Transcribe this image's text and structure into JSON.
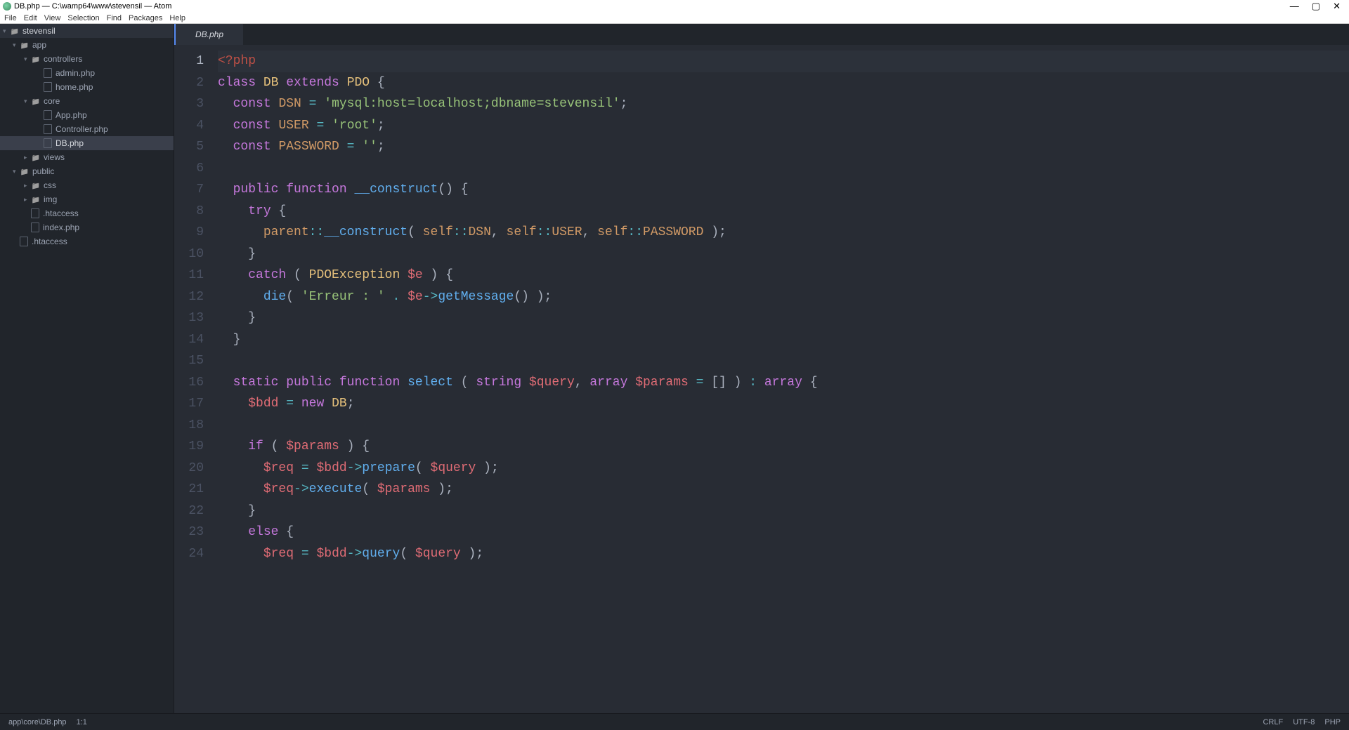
{
  "title": "DB.php — C:\\wamp64\\www\\stevensil — Atom",
  "window": {
    "min": "—",
    "max": "▢",
    "close": "✕"
  },
  "menu": [
    "File",
    "Edit",
    "View",
    "Selection",
    "Find",
    "Packages",
    "Help"
  ],
  "project": {
    "root": "stevensil",
    "tree": [
      {
        "type": "folder",
        "name": "app",
        "open": true,
        "depth": 1
      },
      {
        "type": "folder",
        "name": "controllers",
        "open": true,
        "depth": 2
      },
      {
        "type": "file",
        "name": "admin.php",
        "depth": 3
      },
      {
        "type": "file",
        "name": "home.php",
        "depth": 3
      },
      {
        "type": "folder",
        "name": "core",
        "open": true,
        "depth": 2
      },
      {
        "type": "file",
        "name": "App.php",
        "depth": 3
      },
      {
        "type": "file",
        "name": "Controller.php",
        "depth": 3
      },
      {
        "type": "file",
        "name": "DB.php",
        "depth": 3,
        "selected": true
      },
      {
        "type": "folder",
        "name": "views",
        "open": false,
        "depth": 2
      },
      {
        "type": "folder",
        "name": "public",
        "open": true,
        "depth": 1
      },
      {
        "type": "folder",
        "name": "css",
        "open": false,
        "depth": 2
      },
      {
        "type": "folder",
        "name": "img",
        "open": false,
        "depth": 2
      },
      {
        "type": "file",
        "name": ".htaccess",
        "depth": 2
      },
      {
        "type": "file",
        "name": "index.php",
        "depth": 2
      },
      {
        "type": "file",
        "name": ".htaccess",
        "depth": 1
      }
    ]
  },
  "tab": "DB.php",
  "status": {
    "path": "app\\core\\DB.php",
    "cursor": "1:1",
    "lineend": "CRLF",
    "encoding": "UTF-8",
    "lang": "PHP"
  },
  "code": [
    {
      "n": 1,
      "active": true,
      "spans": [
        [
          "phptag",
          "<?php"
        ]
      ]
    },
    {
      "n": 2,
      "spans": [
        [
          "k",
          "class"
        ],
        [
          "pn",
          " "
        ],
        [
          "cls",
          "DB"
        ],
        [
          "pn",
          " "
        ],
        [
          "k",
          "extends"
        ],
        [
          "pn",
          " "
        ],
        [
          "cls",
          "PDO"
        ],
        [
          "pn",
          " {"
        ]
      ]
    },
    {
      "n": 3,
      "spans": [
        [
          "pn",
          "  "
        ],
        [
          "k",
          "const"
        ],
        [
          "pn",
          " "
        ],
        [
          "cst",
          "DSN"
        ],
        [
          "pn",
          " "
        ],
        [
          "op",
          "="
        ],
        [
          "pn",
          " "
        ],
        [
          "str",
          "'mysql:host=localhost;dbname=stevensil'"
        ],
        [
          "pn",
          ";"
        ]
      ]
    },
    {
      "n": 4,
      "spans": [
        [
          "pn",
          "  "
        ],
        [
          "k",
          "const"
        ],
        [
          "pn",
          " "
        ],
        [
          "cst",
          "USER"
        ],
        [
          "pn",
          " "
        ],
        [
          "op",
          "="
        ],
        [
          "pn",
          " "
        ],
        [
          "str",
          "'root'"
        ],
        [
          "pn",
          ";"
        ]
      ]
    },
    {
      "n": 5,
      "spans": [
        [
          "pn",
          "  "
        ],
        [
          "k",
          "const"
        ],
        [
          "pn",
          " "
        ],
        [
          "cst",
          "PASSWORD"
        ],
        [
          "pn",
          " "
        ],
        [
          "op",
          "="
        ],
        [
          "pn",
          " "
        ],
        [
          "str",
          "''"
        ],
        [
          "pn",
          ";"
        ]
      ]
    },
    {
      "n": 6,
      "spans": []
    },
    {
      "n": 7,
      "spans": [
        [
          "pn",
          "  "
        ],
        [
          "k",
          "public"
        ],
        [
          "pn",
          " "
        ],
        [
          "k",
          "function"
        ],
        [
          "pn",
          " "
        ],
        [
          "fn",
          "__construct"
        ],
        [
          "pn",
          "() {"
        ]
      ]
    },
    {
      "n": 8,
      "spans": [
        [
          "pn",
          "    "
        ],
        [
          "k",
          "try"
        ],
        [
          "pn",
          " {"
        ]
      ]
    },
    {
      "n": 9,
      "spans": [
        [
          "pn",
          "      "
        ],
        [
          "cst",
          "parent"
        ],
        [
          "op",
          "::"
        ],
        [
          "fn",
          "__construct"
        ],
        [
          "pn",
          "( "
        ],
        [
          "cst",
          "self"
        ],
        [
          "op",
          "::"
        ],
        [
          "cst",
          "DSN"
        ],
        [
          "pn",
          ", "
        ],
        [
          "cst",
          "self"
        ],
        [
          "op",
          "::"
        ],
        [
          "cst",
          "USER"
        ],
        [
          "pn",
          ", "
        ],
        [
          "cst",
          "self"
        ],
        [
          "op",
          "::"
        ],
        [
          "cst",
          "PASSWORD"
        ],
        [
          "pn",
          " );"
        ]
      ]
    },
    {
      "n": 10,
      "spans": [
        [
          "pn",
          "    }"
        ]
      ]
    },
    {
      "n": 11,
      "spans": [
        [
          "pn",
          "    "
        ],
        [
          "k",
          "catch"
        ],
        [
          "pn",
          " ( "
        ],
        [
          "cls",
          "PDOException"
        ],
        [
          "pn",
          " "
        ],
        [
          "var",
          "$e"
        ],
        [
          "pn",
          " ) {"
        ]
      ]
    },
    {
      "n": 12,
      "spans": [
        [
          "pn",
          "      "
        ],
        [
          "fn",
          "die"
        ],
        [
          "pn",
          "( "
        ],
        [
          "str",
          "'Erreur : '"
        ],
        [
          "pn",
          " "
        ],
        [
          "op",
          "."
        ],
        [
          "pn",
          " "
        ],
        [
          "var",
          "$e"
        ],
        [
          "op",
          "->"
        ],
        [
          "fn",
          "getMessage"
        ],
        [
          "pn",
          "() );"
        ]
      ]
    },
    {
      "n": 13,
      "spans": [
        [
          "pn",
          "    }"
        ]
      ]
    },
    {
      "n": 14,
      "spans": [
        [
          "pn",
          "  }"
        ]
      ]
    },
    {
      "n": 15,
      "spans": []
    },
    {
      "n": 16,
      "spans": [
        [
          "pn",
          "  "
        ],
        [
          "k",
          "static"
        ],
        [
          "pn",
          " "
        ],
        [
          "k",
          "public"
        ],
        [
          "pn",
          " "
        ],
        [
          "k",
          "function"
        ],
        [
          "pn",
          " "
        ],
        [
          "fn",
          "select"
        ],
        [
          "pn",
          " ( "
        ],
        [
          "k",
          "string"
        ],
        [
          "pn",
          " "
        ],
        [
          "var",
          "$query"
        ],
        [
          "pn",
          ", "
        ],
        [
          "k",
          "array"
        ],
        [
          "pn",
          " "
        ],
        [
          "var",
          "$params"
        ],
        [
          "pn",
          " "
        ],
        [
          "op",
          "="
        ],
        [
          "pn",
          " [] ) "
        ],
        [
          "op",
          ":"
        ],
        [
          "pn",
          " "
        ],
        [
          "k",
          "array"
        ],
        [
          "pn",
          " {"
        ]
      ]
    },
    {
      "n": 17,
      "spans": [
        [
          "pn",
          "    "
        ],
        [
          "var",
          "$bdd"
        ],
        [
          "pn",
          " "
        ],
        [
          "op",
          "="
        ],
        [
          "pn",
          " "
        ],
        [
          "k",
          "new"
        ],
        [
          "pn",
          " "
        ],
        [
          "cls",
          "DB"
        ],
        [
          "pn",
          ";"
        ]
      ]
    },
    {
      "n": 18,
      "spans": []
    },
    {
      "n": 19,
      "spans": [
        [
          "pn",
          "    "
        ],
        [
          "k",
          "if"
        ],
        [
          "pn",
          " ( "
        ],
        [
          "var",
          "$params"
        ],
        [
          "pn",
          " ) {"
        ]
      ]
    },
    {
      "n": 20,
      "spans": [
        [
          "pn",
          "      "
        ],
        [
          "var",
          "$req"
        ],
        [
          "pn",
          " "
        ],
        [
          "op",
          "="
        ],
        [
          "pn",
          " "
        ],
        [
          "var",
          "$bdd"
        ],
        [
          "op",
          "->"
        ],
        [
          "fn",
          "prepare"
        ],
        [
          "pn",
          "( "
        ],
        [
          "var",
          "$query"
        ],
        [
          "pn",
          " );"
        ]
      ]
    },
    {
      "n": 21,
      "spans": [
        [
          "pn",
          "      "
        ],
        [
          "var",
          "$req"
        ],
        [
          "op",
          "->"
        ],
        [
          "fn",
          "execute"
        ],
        [
          "pn",
          "( "
        ],
        [
          "var",
          "$params"
        ],
        [
          "pn",
          " );"
        ]
      ]
    },
    {
      "n": 22,
      "spans": [
        [
          "pn",
          "    }"
        ]
      ]
    },
    {
      "n": 23,
      "spans": [
        [
          "pn",
          "    "
        ],
        [
          "k",
          "else"
        ],
        [
          "pn",
          " {"
        ]
      ]
    },
    {
      "n": 24,
      "spans": [
        [
          "pn",
          "      "
        ],
        [
          "var",
          "$req"
        ],
        [
          "pn",
          " "
        ],
        [
          "op",
          "="
        ],
        [
          "pn",
          " "
        ],
        [
          "var",
          "$bdd"
        ],
        [
          "op",
          "->"
        ],
        [
          "fn",
          "query"
        ],
        [
          "pn",
          "( "
        ],
        [
          "var",
          "$query"
        ],
        [
          "pn",
          " );"
        ]
      ]
    }
  ]
}
